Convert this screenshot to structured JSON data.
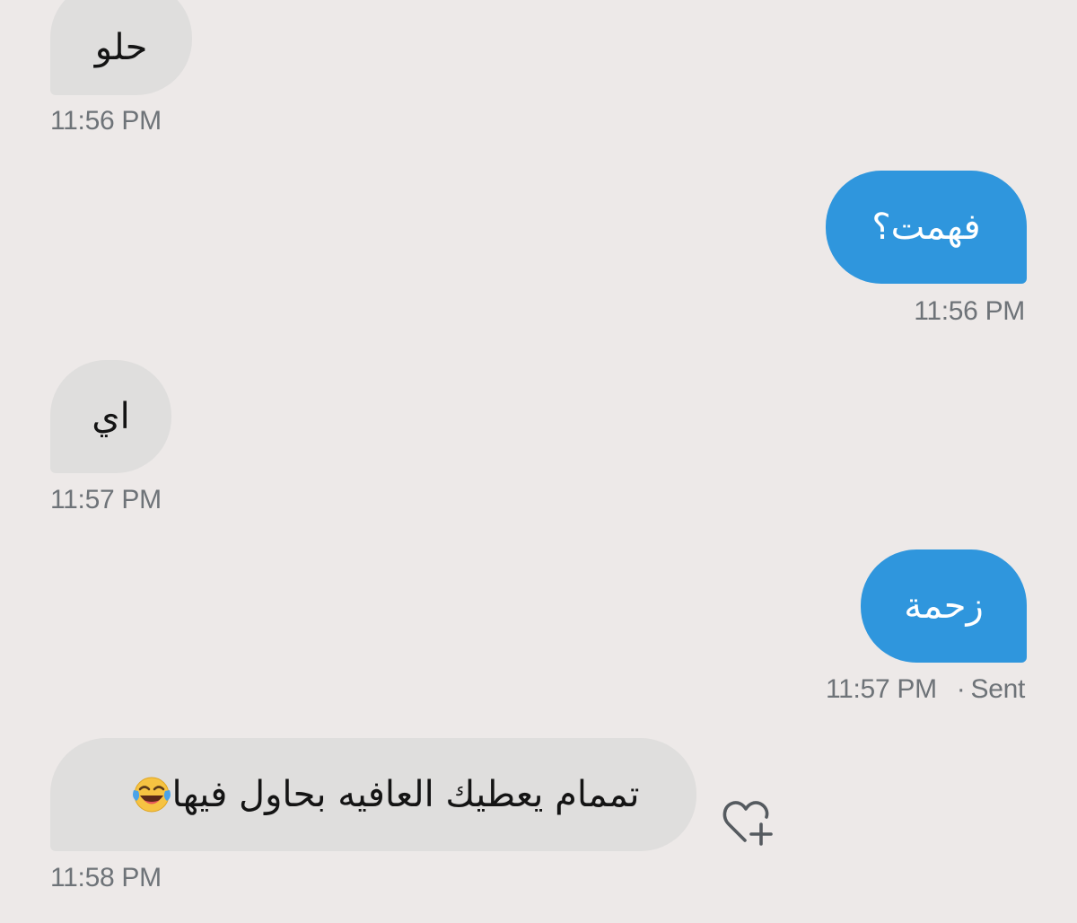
{
  "messages": [
    {
      "direction": "received",
      "text": "حلو",
      "time": "11:56 PM"
    },
    {
      "direction": "sent",
      "text": "فهمت؟",
      "time": "11:56 PM"
    },
    {
      "direction": "received",
      "text": "اي",
      "time": "11:57 PM"
    },
    {
      "direction": "sent",
      "text": "زحمة",
      "time": "11:57 PM",
      "status": "Sent",
      "status_separator": "·"
    },
    {
      "direction": "received",
      "text": "تممام يعطيك العافيه بحاول فيها",
      "emoji": "face-with-tears-of-joy-emoji",
      "time": "11:58 PM"
    }
  ],
  "icons": {
    "react": "heart-plus-icon"
  },
  "colors": {
    "background": "#ede9e8",
    "received_bubble": "#dfdedd",
    "sent_bubble": "#2f96dd",
    "sent_text": "#ffffff",
    "timestamp": "#6e7378"
  }
}
